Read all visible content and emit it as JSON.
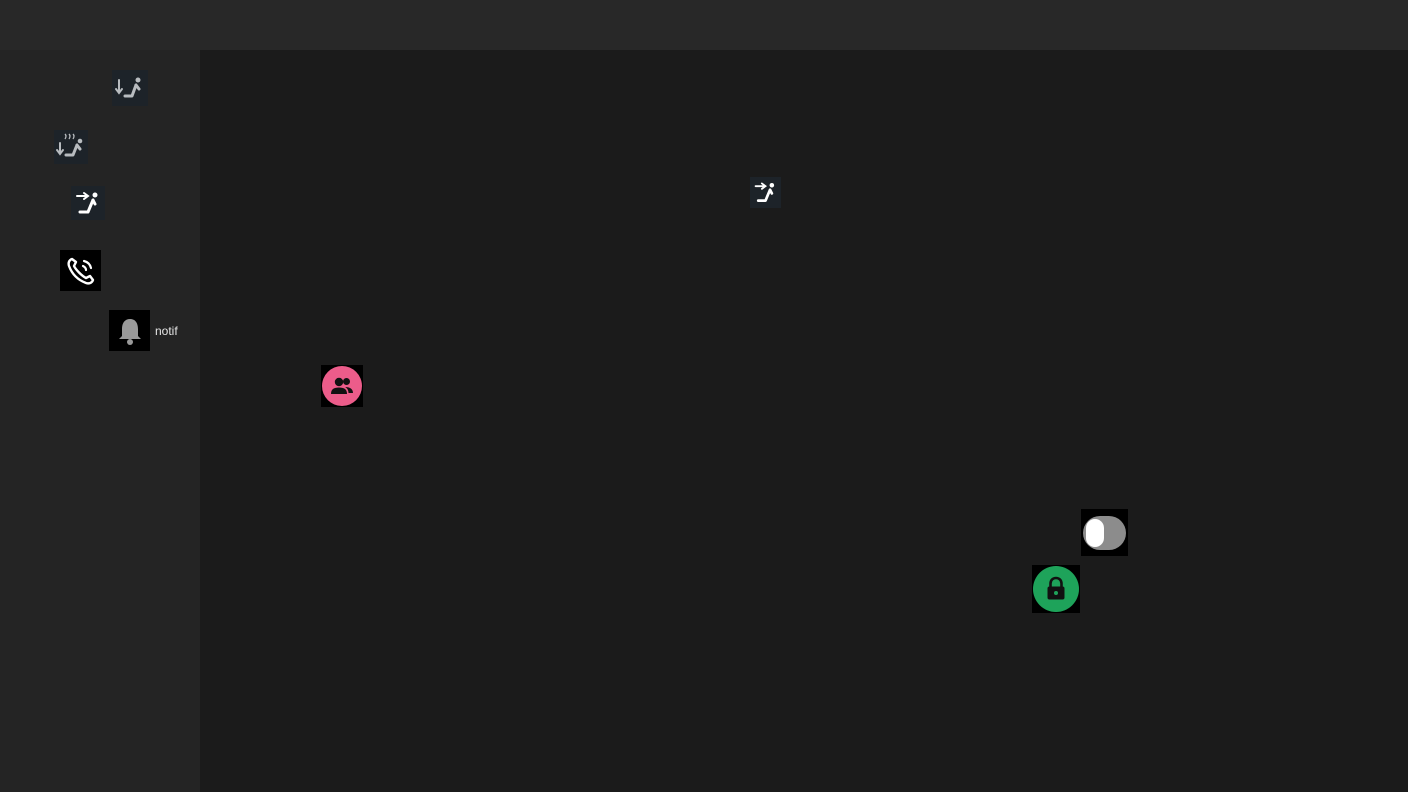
{
  "colors": {
    "topbar": "#282828",
    "sidebar": "#242424",
    "main": "#1b1b1b",
    "seat_icon_bg": "#1d2329",
    "people_accent": "#ec5c8a",
    "lock_accent": "#1ea35a",
    "toggle_track": "#8c8c8c",
    "toggle_knob": "#ffffff"
  },
  "sidebar": {
    "items": [
      {
        "icon": "seat-recline-down-icon"
      },
      {
        "icon": "seat-heat-down-icon"
      },
      {
        "icon": "seat-recline-forward-icon"
      },
      {
        "icon": "phone-call-icon"
      },
      {
        "icon": "bell-icon",
        "label": "notif"
      }
    ]
  },
  "main": {
    "icons": [
      {
        "icon": "seat-recline-forward-icon"
      },
      {
        "icon": "people-group-icon"
      },
      {
        "icon": "lock-icon"
      }
    ],
    "toggle": {
      "state": "off"
    }
  }
}
